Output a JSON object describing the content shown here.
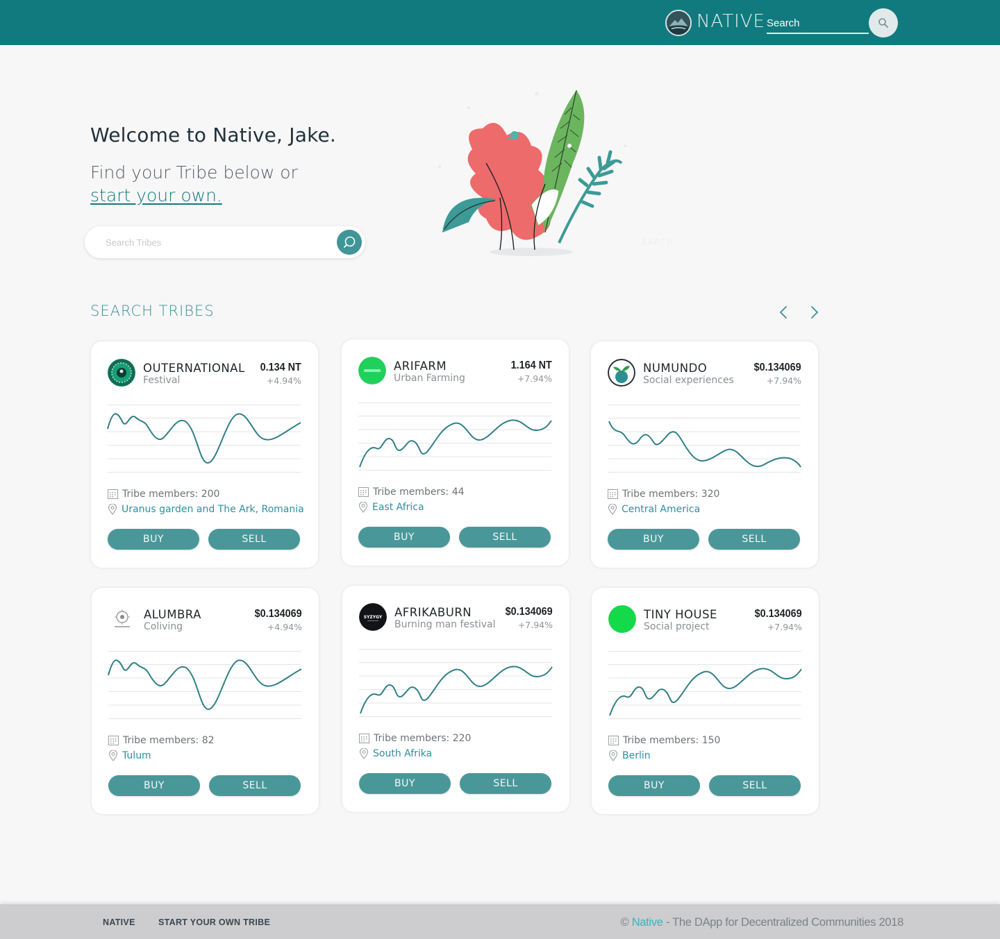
{
  "header": {
    "brand": "NATIVE",
    "search_placeholder": "Search"
  },
  "hero": {
    "welcome": "Welcome to Native, Jake.",
    "find_text": "Find your Tribe below or",
    "start_link": "start your own.",
    "tribe_search_placeholder": "Search Tribes",
    "ghost_search_label": "EARCH"
  },
  "section": {
    "title": "SEARCH TRIBES"
  },
  "colors": {
    "primary": "#117a7e",
    "accent_button": "#4a9799",
    "link": "#2e8fa0",
    "chart_line": "#2f7f86"
  },
  "tribes": [
    {
      "name": "OUTERNATIONAL",
      "category": "Festival",
      "price": "0.134 NT",
      "change": "+4.94%",
      "members": "Tribe members: 200",
      "location": "Uranus garden and The Ark, Romania",
      "avatar": "outernational-logo",
      "chart": "wave-a",
      "buy": "BUY",
      "sell": "SELL"
    },
    {
      "name": "ARIFARM",
      "category": "Urban Farming",
      "price": "1.164 NT",
      "change": "+7.94%",
      "members": "Tribe members: 44",
      "location": "East Africa",
      "avatar": "arifarm-logo",
      "chart": "wave-b",
      "buy": "BUY",
      "sell": "SELL"
    },
    {
      "name": "NUMUNDO",
      "category": "Social experiences",
      "price": "$0.134069",
      "change": "+7.94%",
      "members": "Tribe members: 320",
      "location": "Central America",
      "avatar": "numundo-logo",
      "chart": "wave-c",
      "buy": "BUY",
      "sell": "SELL"
    },
    {
      "name": "ALUMBRA",
      "category": "Coliving",
      "price": "$0.134069",
      "change": "+4.94%",
      "members": "Tribe members: 82",
      "location": "Tulum",
      "avatar": "alumbra-logo",
      "chart": "wave-a",
      "buy": "BUY",
      "sell": "SELL"
    },
    {
      "name": "AFRIKABURN",
      "category": "Burning man festival",
      "price": "$0.134069",
      "change": "+7.94%",
      "members": "Tribe members: 220",
      "location": "South Afrika",
      "avatar": "syzygy-logo",
      "chart": "wave-b",
      "buy": "BUY",
      "sell": "SELL"
    },
    {
      "name": "TINY HOUSE",
      "category": "Social project",
      "price": "$0.134069",
      "change": "+7.94%",
      "members": "Tribe members: 150",
      "location": "Berlin",
      "avatar": "green-dot-logo",
      "chart": "wave-b",
      "buy": "BUY",
      "sell": "SELL"
    }
  ],
  "footer": {
    "link_native": "NATIVE",
    "link_start": "START YOUR OWN TRIBE",
    "copy_prefix": "© ",
    "copy_brand": "Native",
    "copy_rest": " - The DApp for Decentralized Communities 2018"
  }
}
